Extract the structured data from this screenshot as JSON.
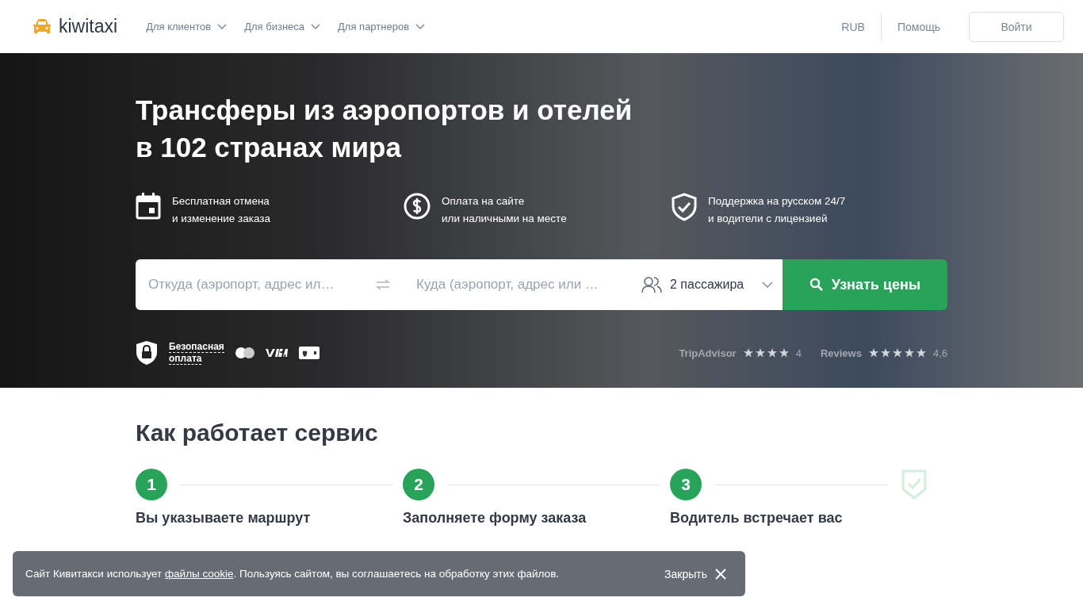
{
  "header": {
    "logo": "kiwitaxi",
    "nav": [
      {
        "label": "Для клиентов"
      },
      {
        "label": "Для бизнеса"
      },
      {
        "label": "Для партнеров"
      }
    ],
    "currency": "RUB",
    "help": "Помощь",
    "login": "Войти"
  },
  "hero": {
    "title_lines": [
      "Трансферы из аэропортов и отелей",
      "в 102 странах мира"
    ],
    "features": [
      {
        "kind": "calendar",
        "lines": [
          "Бесплатная отмена",
          "и изменение заказа"
        ]
      },
      {
        "kind": "dollar",
        "lines": [
          "Оплата на сайте",
          "или наличными на месте"
        ]
      },
      {
        "kind": "shield",
        "lines": [
          "Поддержка на русском 24/7",
          "и водители с лицензией"
        ]
      }
    ],
    "search": {
      "from_placeholder": "Откуда (аэропорт, адрес ил…",
      "to_placeholder": "Куда (аэропорт, адрес или …",
      "passengers": "2 пассажира",
      "button": "Узнать цены"
    },
    "secure_payment": [
      "Безопасная",
      "оплата"
    ],
    "ratings": [
      {
        "name": "TripAdvisor",
        "stars": 4,
        "score": "4"
      },
      {
        "name": "Reviews",
        "stars": 5,
        "score": "4,6"
      }
    ]
  },
  "how": {
    "title": "Как работает сервис",
    "steps": [
      {
        "number": "1",
        "title": "Вы указываете маршрут"
      },
      {
        "number": "2",
        "title": "Заполняете форму заказа"
      },
      {
        "number": "3",
        "title": "Водитель встречает вас"
      }
    ]
  },
  "cookie": {
    "text_before": "Сайт Кивитакси использует ",
    "link": "файлы cookie",
    "text_after": ". Пользуясь сайтом, вы соглашаетесь на обработку этих файлов.",
    "close": "Закрыть"
  }
}
